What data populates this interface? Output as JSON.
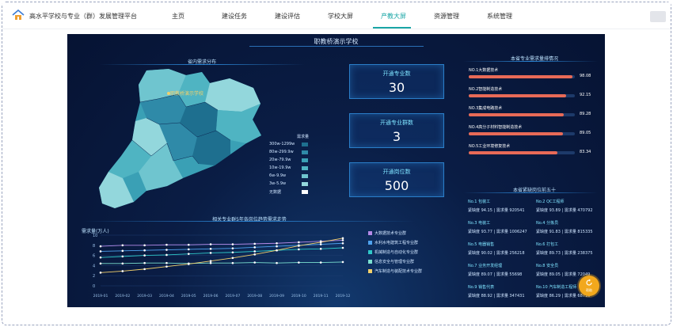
{
  "app": {
    "title": "高水平学校与专业（群）发展管理平台",
    "nav": [
      "主页",
      "建设任务",
      "建设评估",
      "学校大屏",
      "产教大屏",
      "资源管理",
      "系统管理"
    ],
    "active_nav": "产教大屏"
  },
  "dashboard": {
    "title": "职教桥演示学校",
    "map_panel": {
      "title": "省内需求分布",
      "school_label": "职教桥演示学校",
      "legend_title": "需求量",
      "legend": [
        {
          "label": "300w-1299w",
          "color": "#1e6f8f"
        },
        {
          "label": "80w-299.9w",
          "color": "#2f8aa8"
        },
        {
          "label": "20w-79.9w",
          "color": "#3aa0b5"
        },
        {
          "label": "10w-19.9w",
          "color": "#4fb4c2"
        },
        {
          "label": "6w-9.9w",
          "color": "#6fc5cf"
        },
        {
          "label": "3w-5.9w",
          "color": "#93d7dc"
        },
        {
          "label": "无数据",
          "color": "#ffffff"
        }
      ]
    },
    "cards": [
      {
        "label": "开通专业数",
        "value": "30"
      },
      {
        "label": "开通专业群数",
        "value": "3"
      },
      {
        "label": "开通岗位数",
        "value": "500"
      }
    ],
    "rank_panel": {
      "title": "本省专业需求量排情况",
      "items": [
        {
          "label": "NO.1大数据技术",
          "value": 98.08
        },
        {
          "label": "NO.2智能制造技术",
          "value": 92.15
        },
        {
          "label": "NO.3集成电路技术",
          "value": 89.28
        },
        {
          "label": "NO.4高分子材料智能制造技术",
          "value": 89.05
        },
        {
          "label": "NO.5工业环境修复技术",
          "value": 83.34
        }
      ]
    },
    "jobs_panel": {
      "title": "本省紧缺岗位前五十",
      "items": [
        {
          "name": "No.1 包装工",
          "gap": "94.15",
          "demand": "920541"
        },
        {
          "name": "No.2 QC工程师",
          "gap": "93.89",
          "demand": "470792"
        },
        {
          "name": "No.3 电装工",
          "gap": "93.77",
          "demand": "1006247"
        },
        {
          "name": "No.4 分拣员",
          "gap": "91.83",
          "demand": "815335"
        },
        {
          "name": "No.5 电器销售",
          "gap": "90.02",
          "demand": "256218"
        },
        {
          "name": "No.6 打包工",
          "gap": "89.73",
          "demand": "238375"
        },
        {
          "name": "No.7 业务开发经理",
          "gap": "89.07",
          "demand": "55698"
        },
        {
          "name": "No.8 安全员",
          "gap": "89.05",
          "demand": "72049"
        },
        {
          "name": "No.9 销售代表",
          "gap": "88.92",
          "demand": "347431"
        },
        {
          "name": "No.10 汽车制造工程师",
          "gap": "86.29",
          "demand": "68715"
        }
      ],
      "gap_label": "紧缺度",
      "demand_label": "需求量"
    },
    "help_label": "帮助"
  },
  "chart_data": {
    "type": "line",
    "title": "相关专业群5年各岗位趋势需求走势",
    "ylabel": "需求量(万人)",
    "ylim": [
      0,
      10
    ],
    "yticks": [
      0,
      2,
      4,
      6,
      8,
      10
    ],
    "x": [
      "2019-01",
      "2019-02",
      "2019-03",
      "2019-04",
      "2019-05",
      "2019-06",
      "2019-07",
      "2019-08",
      "2019-09",
      "2019-10",
      "2019-11",
      "2019-12"
    ],
    "series": [
      {
        "name": "大数据技术专业群",
        "color": "#b58ae8",
        "values": [
          7.8,
          8.0,
          8.0,
          8.1,
          8.1,
          8.2,
          8.2,
          8.3,
          8.4,
          8.6,
          8.8,
          9.0
        ]
      },
      {
        "name": "水利水电建筑工程专业群",
        "color": "#4fa3f0",
        "values": [
          6.8,
          6.9,
          7.0,
          7.1,
          7.2,
          7.3,
          7.4,
          7.6,
          7.8,
          8.0,
          8.2,
          8.4
        ]
      },
      {
        "name": "机械制造与自动化专业群",
        "color": "#2fc8c8",
        "values": [
          5.6,
          5.8,
          6.0,
          6.1,
          6.3,
          6.5,
          6.6,
          6.8,
          7.0,
          7.2,
          7.3,
          7.5
        ]
      },
      {
        "name": "信息安全与管理专业群",
        "color": "#7be0d0",
        "values": [
          4.4,
          4.4,
          4.5,
          4.5,
          4.4,
          4.5,
          4.5,
          4.6,
          4.5,
          4.6,
          4.6,
          4.7
        ]
      },
      {
        "name": "汽车制造与装配技术专业群",
        "color": "#f2d06b",
        "values": [
          2.6,
          2.9,
          3.3,
          3.8,
          4.3,
          4.9,
          5.5,
          6.2,
          7.0,
          7.9,
          8.6,
          9.4
        ]
      }
    ]
  }
}
